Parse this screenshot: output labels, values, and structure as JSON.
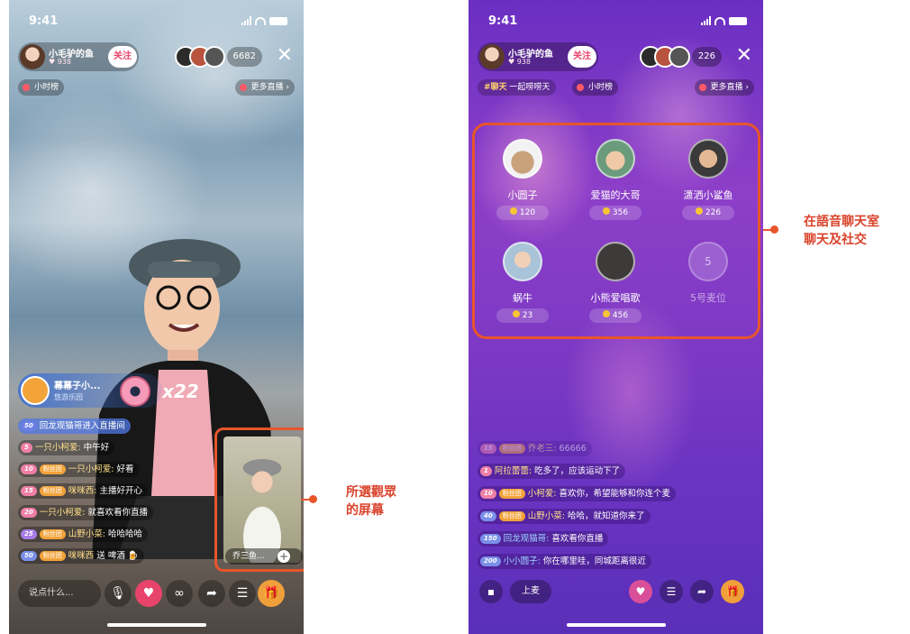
{
  "left_phone": {
    "status_time": "9:41",
    "host": {
      "name": "小毛驴的鱼",
      "fans": "938",
      "follow_label": "关注"
    },
    "viewer_count": "6682",
    "chips": {
      "hour_rank": "小时榜",
      "more_live": "更多直播"
    },
    "gift_banner": {
      "name": "幕幕子小...",
      "sub": "悠游乐园",
      "count": "x22"
    },
    "chat": [
      {
        "level": "50",
        "fan": "",
        "nick": "回龙观猫哥进入直播间",
        "text": ""
      },
      {
        "level": "5",
        "fan": "",
        "nick": "一只小柯爱:",
        "text": "中午好"
      },
      {
        "level": "10",
        "fan": "粉丝团",
        "nick": "一只小柯爱:",
        "text": "好看"
      },
      {
        "level": "15",
        "fan": "粉丝团",
        "nick": "咪咪西:",
        "text": "主播好开心"
      },
      {
        "level": "20",
        "fan": "",
        "nick": "一只小柯爱:",
        "text": "就喜欢看你直播"
      },
      {
        "level": "25",
        "fan": "粉丝团",
        "nick": "山野小菜:",
        "text": "哈哈哈哈"
      },
      {
        "level": "50",
        "fan": "粉丝团",
        "nick": "咪咪西",
        "text": "送 啤酒"
      }
    ],
    "pip_label": "乔三鱼...",
    "input_placeholder": "说点什么..."
  },
  "callouts": {
    "left": [
      "所選觀眾",
      "的屏幕"
    ],
    "right": [
      "在語音聊天室",
      "聊天及社交"
    ]
  },
  "right_phone": {
    "status_time": "9:41",
    "host": {
      "name": "小毛驴的鱼",
      "fans": "938",
      "follow_label": "关注"
    },
    "viewer_count": "226",
    "topic": {
      "tag": "#聊天",
      "text": "一起唠唠天"
    },
    "chips": {
      "hour_rank": "小时榜",
      "more_live": "更多直播"
    },
    "seats": [
      {
        "name": "小圆子",
        "coins": "120"
      },
      {
        "name": "爱猫的大哥",
        "coins": "356"
      },
      {
        "name": "潇洒小鲨鱼",
        "coins": "226"
      },
      {
        "name": "蜗牛",
        "coins": "23"
      },
      {
        "name": "小熊爱唱歌",
        "coins": "456"
      },
      {
        "name": "5号麦位",
        "coins": "",
        "slot": "5"
      }
    ],
    "chat": [
      {
        "level": "15",
        "fan": "粉丝团",
        "nick": "乔老三:",
        "text": "66666"
      },
      {
        "level": "1",
        "fan": "",
        "nick": "阿拉蕾蕾:",
        "text": "吃多了，应该运动下了"
      },
      {
        "level": "10",
        "fan": "粉丝团",
        "nick": "小柯爱:",
        "text": "喜欢你，希望能够和你连个麦"
      },
      {
        "level": "40",
        "fan": "粉丝团",
        "nick": "山野小菜:",
        "text": "哈哈，就知道你来了"
      },
      {
        "level": "150",
        "fan": "",
        "nick": "回龙观猫哥:",
        "text": "喜欢看你直播"
      },
      {
        "level": "200",
        "fan": "",
        "nick": "小小圆子:",
        "text": "你在哪里哇，同城距离很近"
      }
    ],
    "mic_label": "上麦"
  },
  "colors": {
    "callout": "#e8552b",
    "accent_pink": "#e8436a",
    "coin": "#f7c533"
  }
}
